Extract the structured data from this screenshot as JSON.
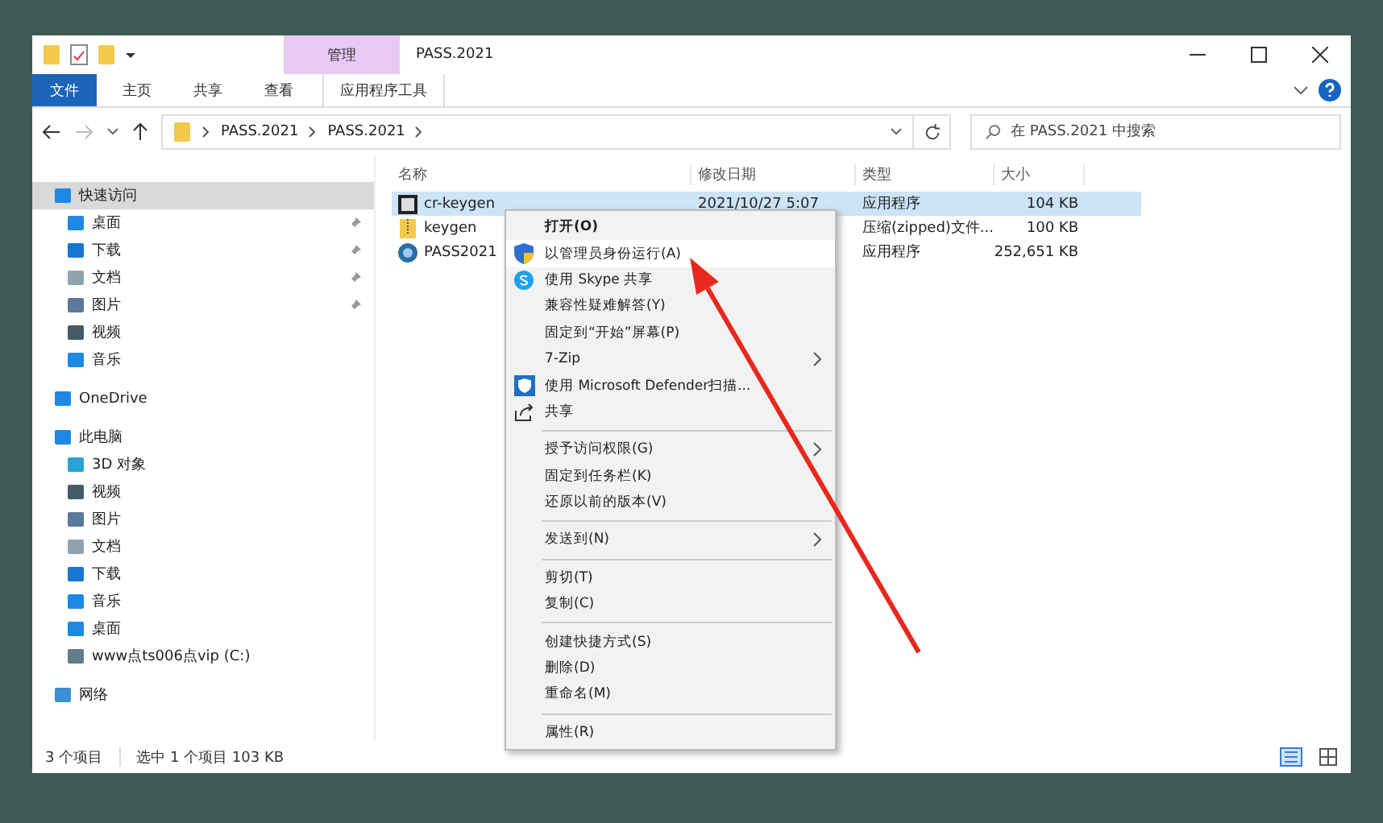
{
  "window": {
    "title": "PASS.2021",
    "context_tab_group": "管理"
  },
  "ribbon_tabs": [
    {
      "label": "文件",
      "kind": "file",
      "selected": false
    },
    {
      "label": "主页",
      "kind": "tab",
      "selected": false
    },
    {
      "label": "共享",
      "kind": "tab",
      "selected": false
    },
    {
      "label": "查看",
      "kind": "tab",
      "selected": false
    },
    {
      "label": "应用程序工具",
      "kind": "context",
      "selected": false
    }
  ],
  "address_bar": {
    "path": [
      "PASS.2021",
      "PASS.2021"
    ]
  },
  "search": {
    "placeholder": "在 PASS.2021 中搜索"
  },
  "sidebar": {
    "items": [
      {
        "label": "快速访问",
        "kind": "star",
        "selected": true,
        "children": [
          {
            "label": "桌面",
            "kind": "desktop",
            "pinned": true
          },
          {
            "label": "下载",
            "kind": "download",
            "pinned": true
          },
          {
            "label": "文档",
            "kind": "document",
            "pinned": true
          },
          {
            "label": "图片",
            "kind": "picture",
            "pinned": true
          },
          {
            "label": "视频",
            "kind": "video",
            "pinned": false
          },
          {
            "label": "音乐",
            "kind": "music",
            "pinned": false
          }
        ]
      },
      {
        "label": "OneDrive",
        "kind": "cloud",
        "selected": false
      },
      {
        "label": "此电脑",
        "kind": "computer",
        "selected": false,
        "children": [
          {
            "label": "3D 对象",
            "kind": "cube",
            "pinned": false
          },
          {
            "label": "视频",
            "kind": "video",
            "pinned": false
          },
          {
            "label": "图片",
            "kind": "picture",
            "pinned": false
          },
          {
            "label": "文档",
            "kind": "document",
            "pinned": false
          },
          {
            "label": "下载",
            "kind": "download",
            "pinned": false
          },
          {
            "label": "音乐",
            "kind": "music",
            "pinned": false
          },
          {
            "label": "桌面",
            "kind": "desktop",
            "pinned": false
          },
          {
            "label": "www点ts006点vip (C:)",
            "kind": "drive",
            "pinned": false
          }
        ]
      },
      {
        "label": "网络",
        "kind": "network",
        "selected": false
      }
    ]
  },
  "file_list": {
    "columns": [
      "名称",
      "修改日期",
      "类型",
      "大小"
    ],
    "rows": [
      {
        "name": "cr-keygen",
        "date": "2021/10/27 5:07",
        "type": "应用程序",
        "size": "104 KB",
        "kind": "app",
        "selected": true
      },
      {
        "name": "keygen",
        "type": "压缩(zipped)文件...",
        "size": "100 KB",
        "kind": "zip",
        "selected": false
      },
      {
        "name": "PASS2021",
        "type": "应用程序",
        "size": "252,651 KB",
        "kind": "setup",
        "selected": false
      }
    ]
  },
  "context_menu": {
    "items": [
      {
        "kind": "plain",
        "label": "打开(O)",
        "bold": true,
        "selected": false
      },
      {
        "kind": "shield",
        "label": "以管理员身份运行(A)",
        "selected": true
      },
      {
        "kind": "skype",
        "label": "使用 Skype 共享",
        "selected": false
      },
      {
        "kind": "plain",
        "label": "兼容性疑难解答(Y)",
        "selected": false
      },
      {
        "kind": "plain",
        "label": "固定到“开始”屏幕(P)",
        "selected": false
      },
      {
        "kind": "plain",
        "label": "7-Zip",
        "submenu": true,
        "selected": false
      },
      {
        "kind": "defender",
        "label": "使用 Microsoft Defender扫描...",
        "selected": false
      },
      {
        "kind": "share",
        "label": "共享",
        "selected": false
      },
      {
        "kind": "separator"
      },
      {
        "kind": "plain",
        "label": "授予访问权限(G)",
        "submenu": true,
        "selected": false
      },
      {
        "kind": "plain",
        "label": "固定到任务栏(K)",
        "selected": false
      },
      {
        "kind": "plain",
        "label": "还原以前的版本(V)",
        "selected": false
      },
      {
        "kind": "separator"
      },
      {
        "kind": "plain",
        "label": "发送到(N)",
        "submenu": true,
        "selected": false
      },
      {
        "kind": "separator"
      },
      {
        "kind": "plain",
        "label": "剪切(T)",
        "selected": false
      },
      {
        "kind": "plain",
        "label": "复制(C)",
        "selected": false
      },
      {
        "kind": "separator"
      },
      {
        "kind": "plain",
        "label": "创建快捷方式(S)",
        "selected": false
      },
      {
        "kind": "plain",
        "label": "删除(D)",
        "selected": false
      },
      {
        "kind": "plain",
        "label": "重命名(M)",
        "selected": false
      },
      {
        "kind": "separator"
      },
      {
        "kind": "plain",
        "label": "属性(R)",
        "selected": false
      }
    ]
  },
  "status_bar": {
    "item_count": "3 个项目",
    "selection": "选中 1 个项目  103 KB"
  }
}
